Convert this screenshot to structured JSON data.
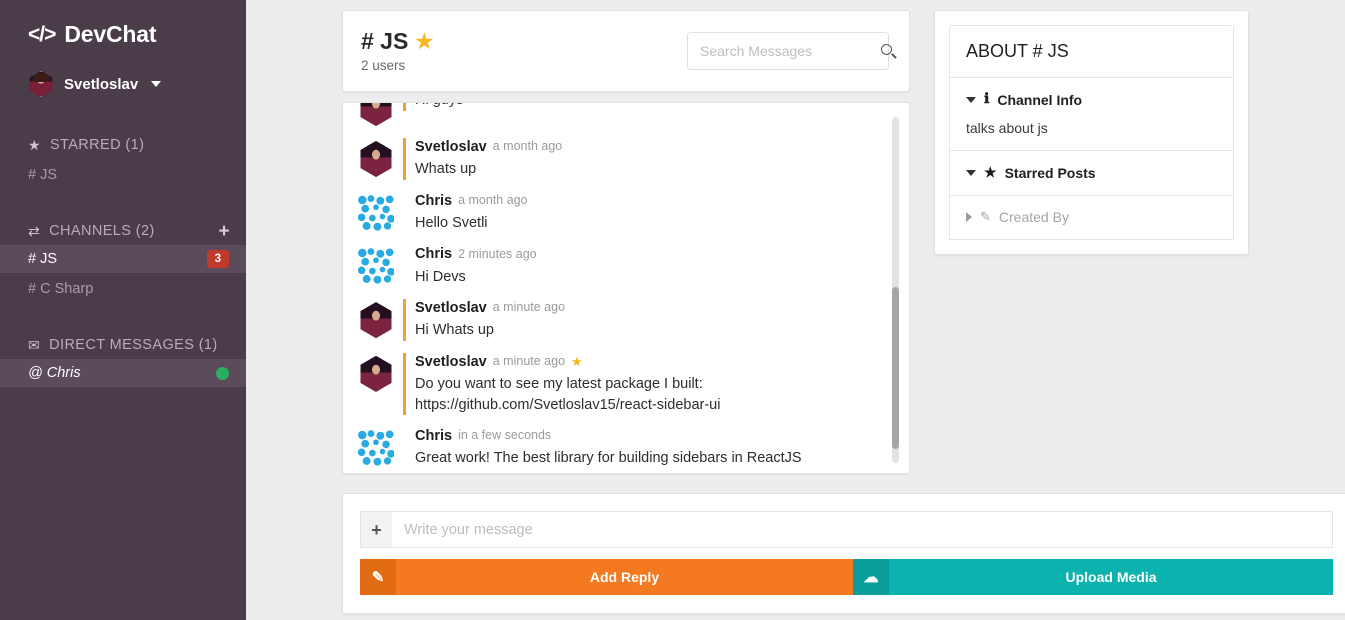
{
  "sidebar": {
    "brand": {
      "icon": "code-brackets-icon",
      "name": "DevChat"
    },
    "user": {
      "name": "Svetloslav",
      "avatar": "user-avatar",
      "caret": "chevron-down-icon"
    },
    "sections": [
      {
        "icon": "star-icon",
        "label": "STARRED (1)",
        "action": null,
        "items": [
          {
            "label": "# JS",
            "badge": null,
            "status": null
          }
        ]
      },
      {
        "icon": "exchange-arrows-icon",
        "label": "CHANNELS (2)",
        "action": "plus-icon",
        "action_label": "+",
        "items": [
          {
            "label": "# JS",
            "badge": "3",
            "status": null,
            "active": true
          },
          {
            "label": "# C Sharp",
            "badge": null,
            "status": null,
            "active": false
          }
        ]
      },
      {
        "icon": "envelope-icon",
        "label": "DIRECT MESSAGES (1)",
        "action": null,
        "items": [
          {
            "label": "@ Chris",
            "badge": null,
            "status": "online"
          }
        ]
      }
    ]
  },
  "header": {
    "channel_title": "# JS",
    "starred_icon": "star-icon",
    "users_count": "2 users",
    "search": {
      "placeholder": "Search Messages",
      "value": "",
      "icon": "search-icon"
    }
  },
  "messages": [
    {
      "author": "",
      "time": "",
      "text": "Hi guys",
      "own": true,
      "avatar": "svetloslav-avatar",
      "starred": false,
      "clipped": true
    },
    {
      "author": "Svetloslav",
      "time": "a month ago",
      "text": "Whats up",
      "own": true,
      "avatar": "svetloslav-avatar",
      "starred": false
    },
    {
      "author": "Chris",
      "time": "a month ago",
      "text": "Hello Svetli",
      "own": false,
      "avatar": "chris-avatar",
      "starred": false
    },
    {
      "author": "Chris",
      "time": "2 minutes ago",
      "text": "Hi Devs",
      "own": false,
      "avatar": "chris-avatar",
      "starred": false
    },
    {
      "author": "Svetloslav",
      "time": "a minute ago",
      "text": "Hi Whats up",
      "own": true,
      "avatar": "svetloslav-avatar",
      "starred": false
    },
    {
      "author": "Svetloslav",
      "time": "a minute ago",
      "text": "Do you want to see my latest package I built: https://github.com/Svetloslav15/react-sidebar-ui",
      "own": true,
      "avatar": "svetloslav-avatar",
      "starred": true
    },
    {
      "author": "Chris",
      "time": "in a few seconds",
      "text": "Great work! The best library for building sidebars in ReactJS",
      "own": false,
      "avatar": "chris-avatar",
      "starred": false
    }
  ],
  "compose": {
    "attach_icon": "plus-icon",
    "attach_label": "+",
    "placeholder": "Write your message",
    "value": "",
    "buttons": [
      {
        "label": "Add Reply",
        "icon": "compose-pencil-icon",
        "glyph": "✎",
        "color": "#f47920"
      },
      {
        "label": "Upload Media",
        "icon": "cloud-upload-icon",
        "glyph": "☁",
        "color": "#0cb3ae"
      }
    ]
  },
  "about": {
    "title": "ABOUT # JS",
    "sections": [
      {
        "label": "Channel Info",
        "icon": "info-icon",
        "expanded": true,
        "body": "talks about js"
      },
      {
        "label": "Starred Posts",
        "icon": "star-icon",
        "expanded": true,
        "body": ""
      },
      {
        "label": "Created By",
        "icon": "pencil-icon",
        "expanded": false,
        "body": ""
      }
    ]
  },
  "colors": {
    "sidebar_bg": "#4b3c4a",
    "sidebar_active": "#5c4b5b",
    "badge_red": "#c0392b",
    "online_green": "#27ae60",
    "accent_orange": "#f47920",
    "accent_teal": "#0cb3ae",
    "star_gold": "#f6b81c",
    "page_bg": "#ededed"
  }
}
